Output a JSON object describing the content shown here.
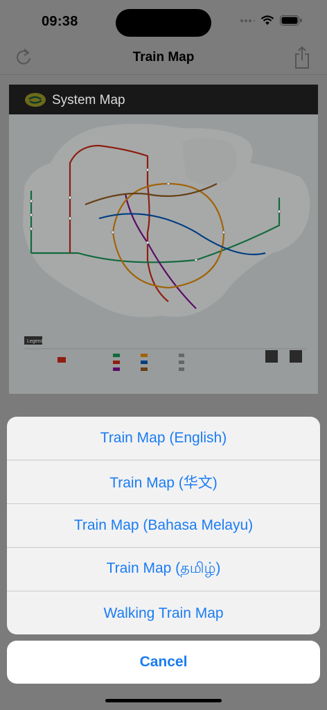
{
  "status": {
    "time": "09:38"
  },
  "nav": {
    "title": "Train Map",
    "left_icon": "refresh-icon",
    "right_icon": "share-icon"
  },
  "map": {
    "header_title": "System Map",
    "legend_label": "Legend"
  },
  "action_sheet": {
    "options": [
      "Train Map (English)",
      "Train Map (华文)",
      "Train Map (Bahasa Melayu)",
      "Train Map (தமிழ்)",
      "Walking Train Map"
    ],
    "cancel_label": "Cancel"
  },
  "colors": {
    "accent": "#1a7cf2",
    "line_red": "#d42e12",
    "line_green": "#009645",
    "line_purple": "#9900aa",
    "line_orange": "#fa9e0d",
    "line_blue": "#005ec4",
    "line_brown": "#9d5b25"
  }
}
